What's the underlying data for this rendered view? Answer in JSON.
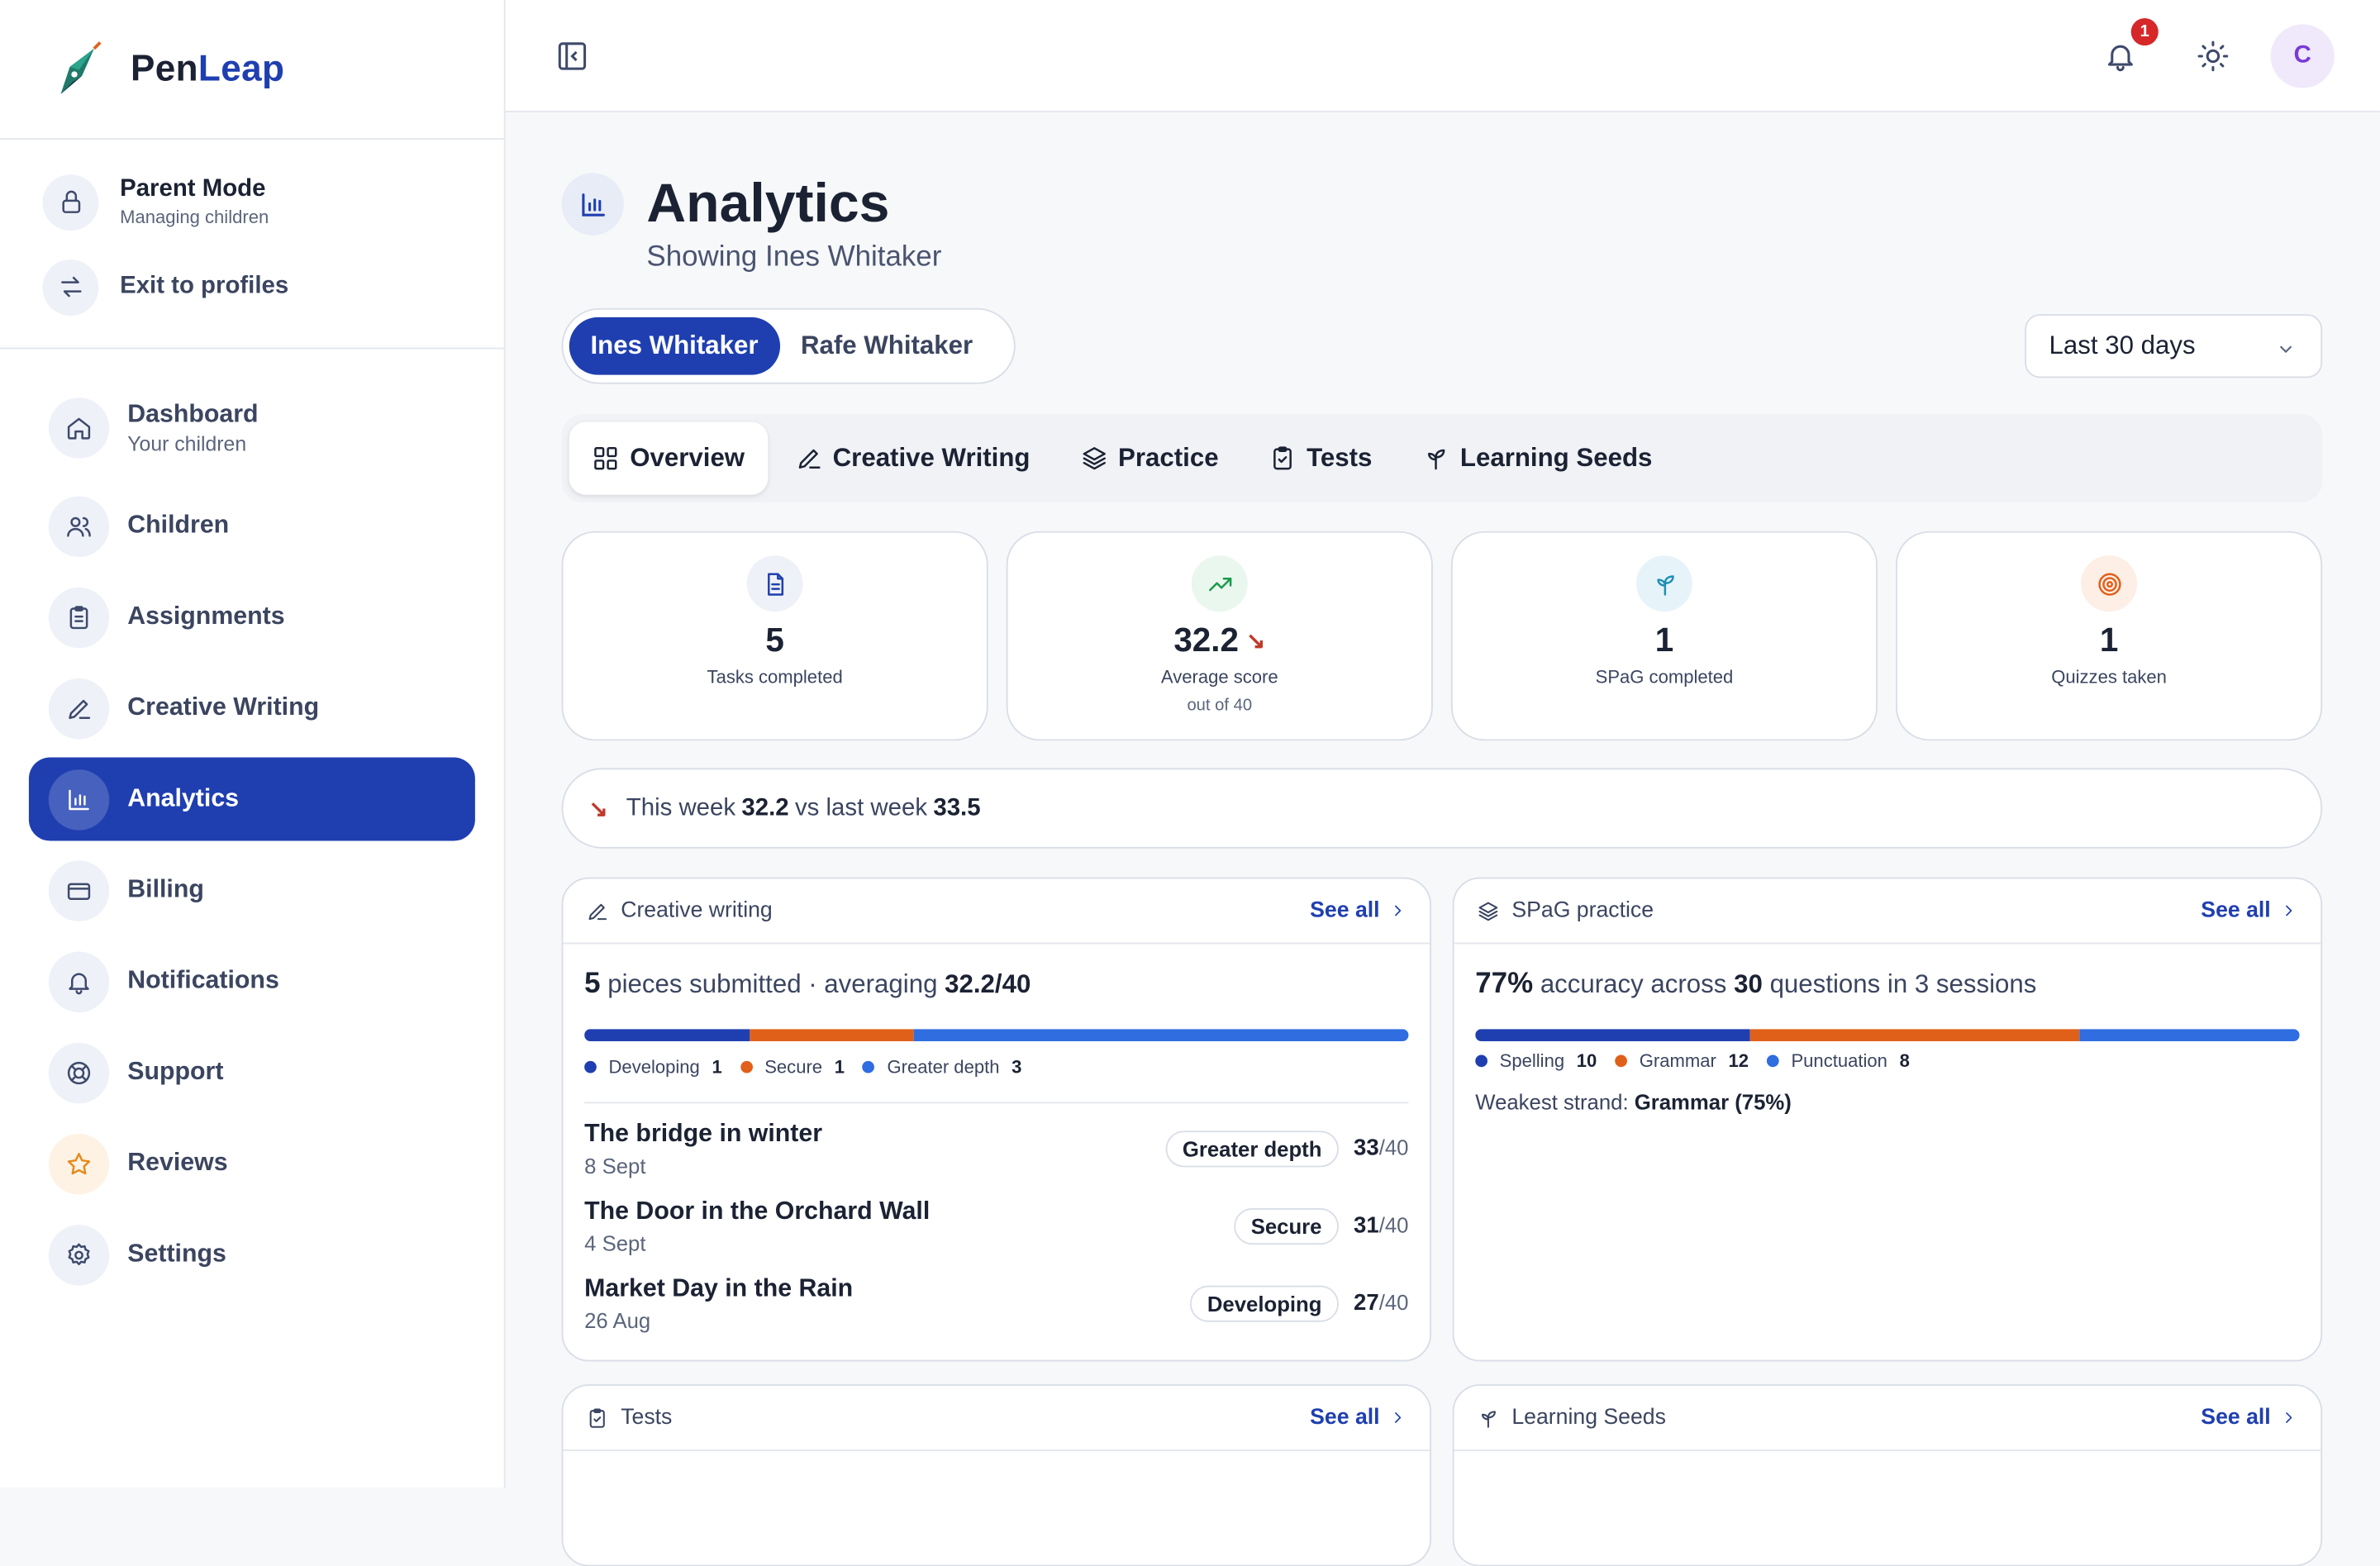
{
  "brand": {
    "name_part1": "Pen",
    "name_part2": "Leap"
  },
  "parent_mode": {
    "title": "Parent Mode",
    "subtitle": "Managing children",
    "exit_label": "Exit to profiles"
  },
  "nav": {
    "dashboard": {
      "label": "Dashboard",
      "sub": "Your children"
    },
    "children": "Children",
    "assignments": "Assignments",
    "creative_writing": "Creative Writing",
    "analytics": "Analytics",
    "billing": "Billing",
    "notifications": "Notifications",
    "support": "Support",
    "reviews": "Reviews",
    "settings": "Settings"
  },
  "topbar": {
    "notification_count": "1",
    "avatar_initial": "C"
  },
  "page": {
    "title": "Analytics",
    "subtitle": "Showing Ines Whitaker"
  },
  "children_switch": [
    "Ines Whitaker",
    "Rafe Whitaker"
  ],
  "period": "Last 30 days",
  "tabs": [
    "Overview",
    "Creative Writing",
    "Practice",
    "Tests",
    "Learning Seeds"
  ],
  "stats": [
    {
      "value": "5",
      "label": "Tasks completed",
      "color": "#eef1f8"
    },
    {
      "value": "32.2",
      "trend": "↘",
      "label": "Average score",
      "sub": "out of 40",
      "color": "#e9f7ee"
    },
    {
      "value": "1",
      "label": "SPaG completed",
      "color": "#e6f4fa"
    },
    {
      "value": "1",
      "label": "Quizzes taken",
      "color": "#fdeee6"
    }
  ],
  "comparison": {
    "arrow": "↘",
    "prefix": "This week",
    "this_week": "32.2",
    "middle": "vs last week",
    "last_week": "33.5"
  },
  "creative_card": {
    "title": "Creative writing",
    "see_all": "See all",
    "count": "5",
    "text1": "pieces submitted · averaging",
    "avg": "32.2/40",
    "distribution": [
      {
        "name": "Developing",
        "count": "1",
        "value": 1,
        "color": "#1f3fb0"
      },
      {
        "name": "Secure",
        "count": "1",
        "value": 1,
        "color": "#e0601a"
      },
      {
        "name": "Greater depth",
        "count": "3",
        "value": 3,
        "color": "#2f6de0"
      }
    ],
    "pieces": [
      {
        "title": "The bridge in winter",
        "date": "8 Sept",
        "level": "Greater depth",
        "score": "33",
        "out_of": "/40"
      },
      {
        "title": "The Door in the Orchard Wall",
        "date": "4 Sept",
        "level": "Secure",
        "score": "31",
        "out_of": "/40"
      },
      {
        "title": "Market Day in the Rain",
        "date": "26 Aug",
        "level": "Developing",
        "score": "27",
        "out_of": "/40"
      }
    ]
  },
  "spag_card": {
    "title": "SPaG practice",
    "see_all": "See all",
    "accuracy": "77%",
    "text1": "accuracy across",
    "questions": "30",
    "text2": "questions in 3 sessions",
    "distribution": [
      {
        "name": "Spelling",
        "count": "10",
        "value": 10,
        "color": "#1f3fb0"
      },
      {
        "name": "Grammar",
        "count": "12",
        "value": 12,
        "color": "#e0601a"
      },
      {
        "name": "Punctuation",
        "count": "8",
        "value": 8,
        "color": "#2f6de0"
      }
    ],
    "weak_label": "Weakest strand:",
    "weak_value": "Grammar (75%)"
  },
  "tests_card": {
    "title": "Tests",
    "see_all": "See all"
  },
  "seeds_card": {
    "title": "Learning Seeds",
    "see_all": "See all"
  }
}
